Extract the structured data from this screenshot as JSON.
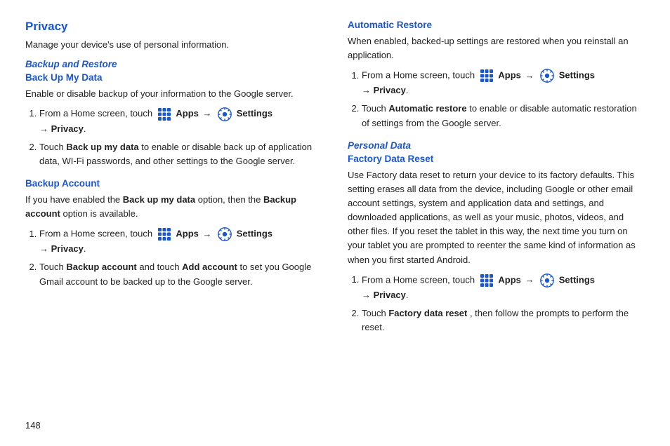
{
  "page": {
    "number": "148"
  },
  "left": {
    "section_title": "Privacy",
    "intro": "Manage your device's use of personal information.",
    "backup_restore_label": "Backup and Restore",
    "back_up_my_data_label": "Back Up My Data",
    "back_up_body": "Enable or disable backup of your information to the Google server.",
    "back_up_step1_pre": "From a Home screen, touch",
    "apps_label": "Apps",
    "arrow": "→",
    "settings_label": "Settings",
    "privacy_arrow": "→",
    "privacy_label": "Privacy",
    "back_up_step2_pre": "Touch",
    "back_up_my_data_bold": "Back up my data",
    "back_up_step2_post": "to enable or disable back up of application data, WI-Fi passwords, and other settings to the Google server.",
    "backup_account_label": "Backup Account",
    "backup_account_body1": "If you have enabled the",
    "backup_account_body_bold1": "Back up my data",
    "backup_account_body2": "option, then the",
    "backup_account_body_bold2": "Backup account",
    "backup_account_body3": "option is available.",
    "backup_acct_step1_pre": "From a Home screen, touch",
    "backup_acct_step2_pre": "Touch",
    "backup_acct_step2_bold1": "Backup account",
    "backup_acct_step2_mid": "and touch",
    "backup_acct_step2_bold2": "Add account",
    "backup_acct_step2_post": "to set you Google Gmail account to be backed up to the Google server."
  },
  "right": {
    "automatic_restore_label": "Automatic Restore",
    "auto_restore_body": "When enabled, backed-up settings are restored when you reinstall an application.",
    "auto_step1_pre": "From a Home screen, touch",
    "apps_label": "Apps",
    "arrow": "→",
    "settings_label": "Settings",
    "privacy_arrow": "→",
    "privacy_label": "Privacy",
    "auto_step2_pre": "Touch",
    "auto_step2_bold": "Automatic restore",
    "auto_step2_post": "to enable or disable automatic restoration of settings from the Google server.",
    "personal_data_label": "Personal Data",
    "factory_data_reset_label": "Factory Data Reset",
    "factory_body": "Use Factory data reset to return your device to its factory defaults. This setting erases all data from the device, including Google or other email account settings, system and application data and settings, and downloaded applications, as well as your music, photos, videos, and other files. If you reset the tablet in this way, the next time you turn on your tablet you are prompted to reenter the same kind of information as when you first started Android.",
    "factory_step1_pre": "From a Home screen, touch",
    "factory_step2_pre": "Touch",
    "factory_step2_bold": "Factory data reset",
    "factory_step2_post": ", then follow the prompts to perform the reset."
  }
}
